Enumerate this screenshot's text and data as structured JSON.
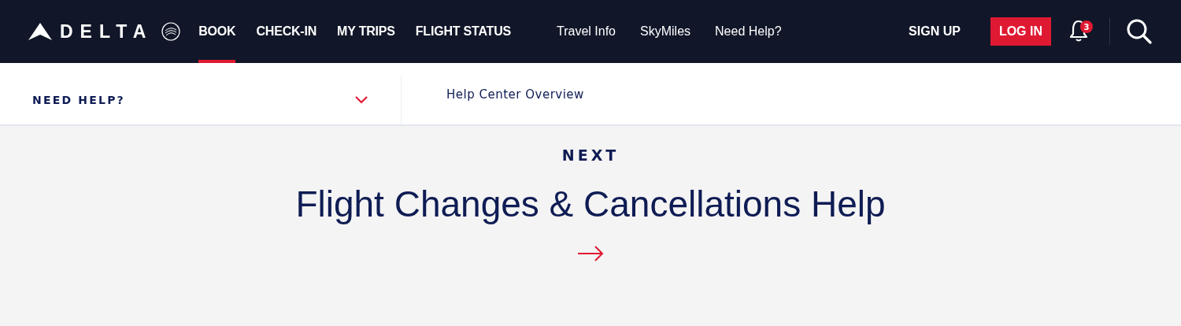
{
  "header": {
    "brand": "DELTA",
    "primary_nav": [
      {
        "label": "BOOK",
        "selected": true
      },
      {
        "label": "CHECK-IN",
        "selected": false
      },
      {
        "label": "MY TRIPS",
        "selected": false
      },
      {
        "label": "FLIGHT STATUS",
        "selected": false
      }
    ],
    "secondary_nav": [
      "Travel Info",
      "SkyMiles",
      "Need Help?"
    ],
    "sign_up": "SIGN UP",
    "log_in": "LOG IN",
    "notification_count": "3"
  },
  "subnav": {
    "dropdown": {
      "label": "NEED HELP?",
      "expanded": false
    },
    "links": [
      "Help Center Overview"
    ]
  },
  "next": {
    "eyebrow": "NEXT",
    "title": "Flight Changes & Cancellations Help"
  }
}
